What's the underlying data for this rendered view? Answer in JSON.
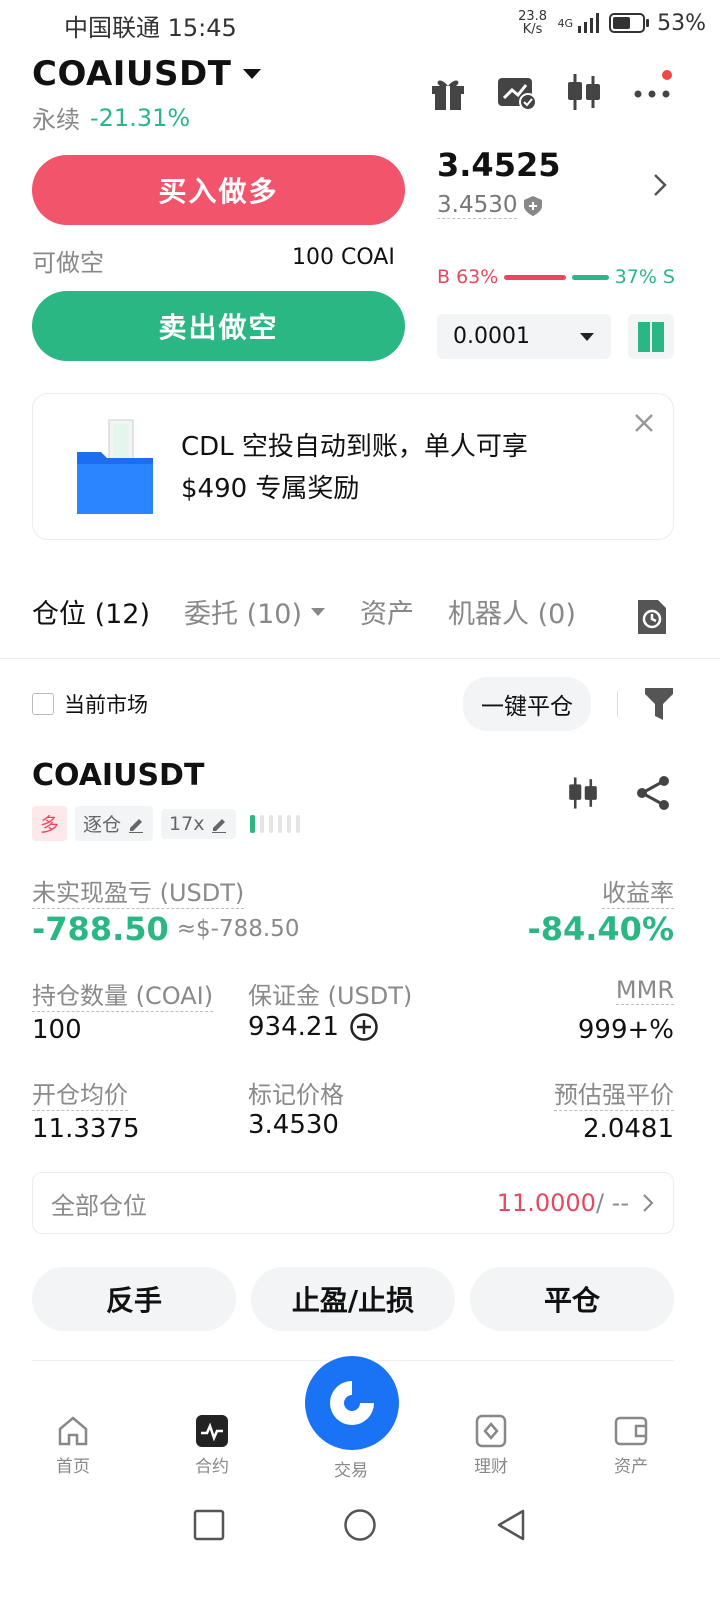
{
  "status_bar": {
    "carrier_time": "中国联通 15:45",
    "net_speed": "23.8 K/s",
    "net_type": "4G",
    "battery": "53%"
  },
  "header": {
    "symbol": "COAIUSDT",
    "contract_type": "永续",
    "change": "-21.31%"
  },
  "order": {
    "buy_label": "买入做多",
    "sell_label": "卖出做空",
    "available_label": "可做空",
    "available_value": "100 COAI"
  },
  "book": {
    "last_price": "3.4525",
    "mark_price": "3.4530",
    "buy_ratio": "B 63%",
    "sell_ratio": "37% S",
    "buy_ratio_value": 0.63,
    "tick_size": "0.0001"
  },
  "promo": {
    "line1": "CDL 空投自动到账，单人可享",
    "line2": "$490 专属奖励"
  },
  "tabs": [
    {
      "label": "仓位 (12)"
    },
    {
      "label": "委托 (10)"
    },
    {
      "label": "资产"
    },
    {
      "label": "机器人 (0)"
    }
  ],
  "filter": {
    "current_market": "当前市场",
    "close_all": "一键平仓"
  },
  "position": {
    "symbol": "COAIUSDT",
    "side": "多",
    "margin_mode": "逐仓",
    "leverage": "17x",
    "upnl_label": "未实现盈亏 (USDT)",
    "upnl_value": "-788.50",
    "upnl_approx": "≈$-788.50",
    "roe_label": "收益率",
    "roe_value": "-84.40%",
    "qty_label": "持仓数量 (COAI)",
    "qty_value": "100",
    "margin_label": "保证金 (USDT)",
    "margin_value": "934.21",
    "mmr_label": "MMR",
    "mmr_value": "999+%",
    "entry_label": "开仓均价",
    "entry_value": "11.3375",
    "mark_label": "标记价格",
    "mark_value": "3.4530",
    "liq_label": "预估强平价",
    "liq_value": "2.0481",
    "all_label": "全部仓位",
    "all_value": "11.0000",
    "all_suffix": " / --"
  },
  "actions": {
    "reverse": "反手",
    "tpsl": "止盈/止损",
    "close": "平仓"
  },
  "nav": [
    {
      "label": "首页",
      "icon": "home-icon"
    },
    {
      "label": "合约",
      "icon": "futures-icon"
    },
    {
      "label": "交易",
      "icon": "trade-icon"
    },
    {
      "label": "理财",
      "icon": "earn-icon"
    },
    {
      "label": "资产",
      "icon": "wallet-icon"
    }
  ],
  "colors": {
    "buy": "#f2546b",
    "sell": "#2bb783",
    "accent": "#1a73f5",
    "warn": "#f0913a"
  }
}
